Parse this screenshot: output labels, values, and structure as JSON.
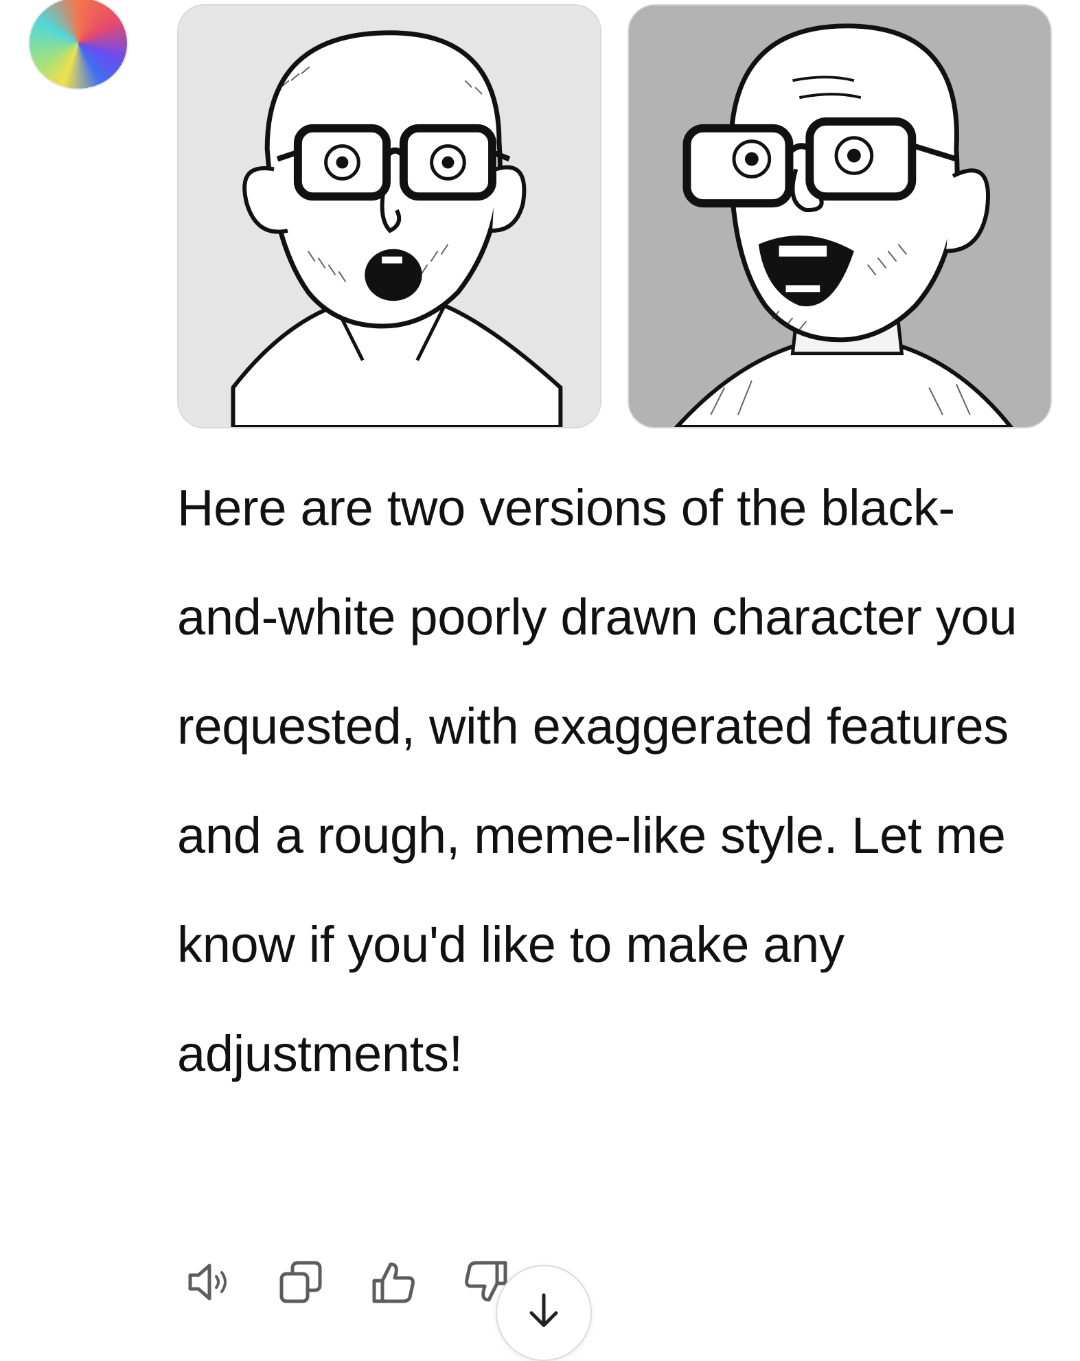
{
  "assistant": {
    "avatar_icon": "multicolor-orb-icon"
  },
  "images": [
    {
      "alt": "",
      "background": "#e5e5e5"
    },
    {
      "alt": "",
      "background": "#b3b3b3"
    }
  ],
  "message": {
    "text": "Here are two versions of the black-and-white poorly drawn character you requested, with exaggerated features and a rough, meme-like style. Let me know if you'd like to make any adjustments!"
  },
  "actions": {
    "read_aloud_icon": "speaker-icon",
    "copy_icon": "copy-icon",
    "like_icon": "thumbs-up-icon",
    "dislike_icon": "thumbs-down-icon",
    "scroll_icon": "arrow-down-icon"
  },
  "colors": {
    "text": "#111111",
    "icon": "#5d5d5d",
    "card_border": "#d9d9d9"
  }
}
